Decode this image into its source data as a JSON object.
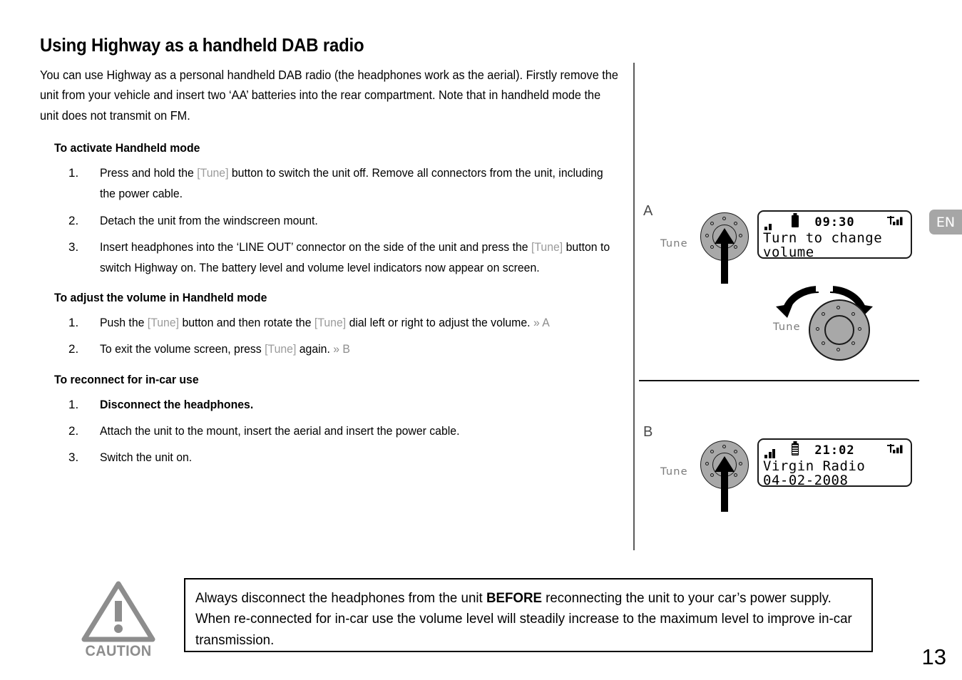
{
  "page": {
    "title": "Using Highway as a handheld DAB radio",
    "intro": "You can use Highway as a personal handheld DAB radio (the headphones work as the aerial). Firstly remove the unit from your vehicle and insert two ‘AA’ batteries into the rear compartment. Note that in handheld mode the unit does not transmit on FM.",
    "number": "13",
    "language_tab": "EN"
  },
  "sections": [
    {
      "heading": "To activate Handheld mode",
      "steps": [
        {
          "num": "1.",
          "bold": false,
          "parts": [
            {
              "t": "Press and hold the ",
              "style": "plain"
            },
            {
              "t": "[Tune]",
              "style": "tune"
            },
            {
              "t": " button to switch the unit off. Remove all connectors from the unit, including the power cable.",
              "style": "plain"
            }
          ]
        },
        {
          "num": "2.",
          "bold": false,
          "parts": [
            {
              "t": "Detach the unit from the windscreen mount.",
              "style": "plain"
            }
          ]
        },
        {
          "num": "3.",
          "bold": false,
          "parts": [
            {
              "t": "Insert headphones into the ‘LINE OUT’ connector on the side of the unit and press the ",
              "style": "plain"
            },
            {
              "t": "[Tune]",
              "style": "tune"
            },
            {
              "t": " button to switch Highway on. The battery level and volume level indicators now appear on screen.",
              "style": "plain"
            }
          ]
        }
      ]
    },
    {
      "heading": "To adjust the volume in Handheld mode",
      "steps": [
        {
          "num": "1.",
          "bold": false,
          "parts": [
            {
              "t": "Push the ",
              "style": "plain"
            },
            {
              "t": "[Tune]",
              "style": "tune"
            },
            {
              "t": " button and then rotate the ",
              "style": "plain"
            },
            {
              "t": "[Tune]",
              "style": "tune"
            },
            {
              "t": " dial left or right to adjust the volume. ",
              "style": "plain"
            },
            {
              "t": "» A",
              "style": "xref"
            }
          ]
        },
        {
          "num": "2.",
          "bold": false,
          "parts": [
            {
              "t": "To exit the volume screen, press ",
              "style": "plain"
            },
            {
              "t": "[Tune]",
              "style": "tune"
            },
            {
              "t": " again. ",
              "style": "plain"
            },
            {
              "t": "» B",
              "style": "xref"
            }
          ]
        }
      ]
    },
    {
      "heading": "To reconnect for in-car use",
      "steps": [
        {
          "num": "1.",
          "bold": true,
          "parts": [
            {
              "t": "Disconnect the headphones.",
              "style": "plain"
            }
          ]
        },
        {
          "num": "2.",
          "bold": false,
          "parts": [
            {
              "t": "Attach the unit to the mount, insert the aerial and insert the power cable.",
              "style": "plain"
            }
          ]
        },
        {
          "num": "3.",
          "bold": false,
          "parts": [
            {
              "t": "Switch the unit on.",
              "style": "plain"
            }
          ]
        }
      ]
    }
  ],
  "illustrations": {
    "panel_a": {
      "letter": "A",
      "knob_label": "Tune",
      "dial_label": "Tune",
      "lcd": {
        "time": "09:30",
        "line1": "Turn to change",
        "line2": "volume",
        "battery": "full",
        "volume_bars": 2,
        "signal_bars": 3
      }
    },
    "panel_b": {
      "letter": "B",
      "knob_label": "Tune",
      "lcd": {
        "time": "21:02",
        "line1": "Virgin Radio",
        "line2": "04-02-2008",
        "battery": "striped",
        "volume_bars": 3,
        "signal_bars": 3
      }
    }
  },
  "caution": {
    "label": "CAUTION",
    "parts": [
      {
        "t": "Always disconnect the headphones from the unit ",
        "style": "plain"
      },
      {
        "t": "BEFORE",
        "style": "bold"
      },
      {
        "t": " reconnecting the unit to your car’s power supply. When re-connected for in-car use the volume level will steadily increase to the maximum level to improve in-car transmission.",
        "style": "plain"
      }
    ]
  },
  "colors": {
    "tune_ref": "#9b9b9b",
    "xref": "#8d8d8d",
    "knob_fill": "#a8a8a8",
    "caution_gray": "#8d8d8d",
    "en_tab": "#a6a6a6"
  }
}
